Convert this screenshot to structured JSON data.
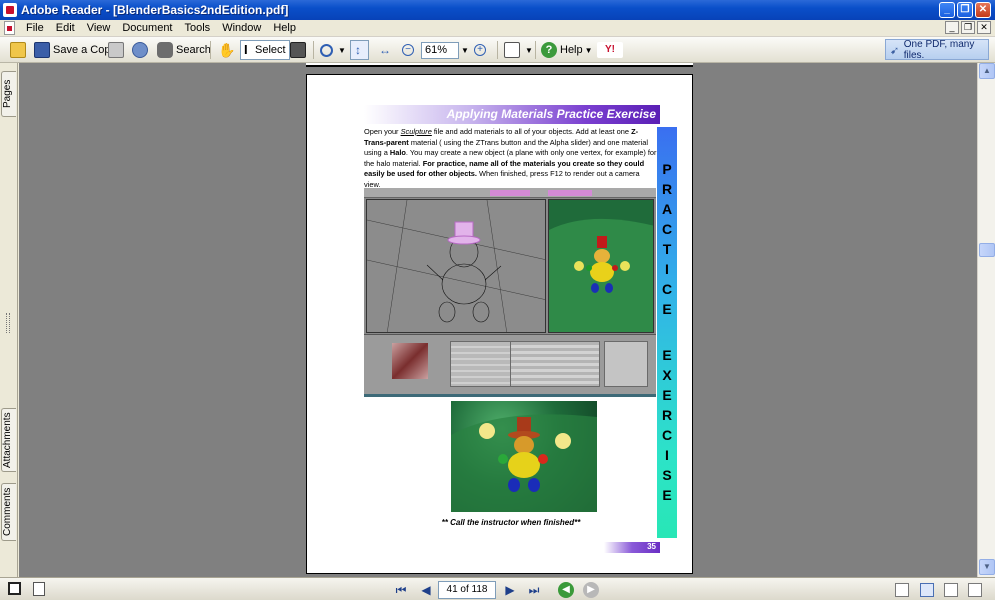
{
  "window": {
    "title": "Adobe Reader - [BlenderBasics2ndEdition.pdf]"
  },
  "menu": [
    "File",
    "Edit",
    "View",
    "Document",
    "Tools",
    "Window",
    "Help"
  ],
  "toolbar": {
    "save_copy_label": "Save a Copy",
    "search_label": "Search",
    "select_label": "Select",
    "zoom_value": "61%",
    "help_label": "Help",
    "promo_text": "One PDF, many files."
  },
  "side_tabs": {
    "pages": "Pages",
    "attachments": "Attachments",
    "comments": "Comments"
  },
  "page": {
    "heading": "Applying Materials Practice Exercise",
    "body_part1": "Open your ",
    "body_sculpture": "Sculpture",
    "body_part2": " file and add materials to all of your objects. Add at least one ",
    "body_bold1": "Z-Trans-parent",
    "body_part3": " material ( using the ZTrans button and the Alpha slider) and one material using a ",
    "body_bold2": "Halo",
    "body_part4": ". You may create a new object (a plane with only one vertex, for example) for the halo material. ",
    "body_bold3": "For practice, name all of the materials you create so they could easily be used for other objects.",
    "body_part5": " When finished, press F12 to render out a camera view.",
    "side_letters_top": [
      "P",
      "R",
      "A",
      "C",
      "T",
      "I",
      "C",
      "E"
    ],
    "side_letters_bottom": [
      "E",
      "X",
      "E",
      "R",
      "C",
      "I",
      "S",
      "E"
    ],
    "caption": "** Call the instructor when finished**",
    "page_number": "35"
  },
  "navigation": {
    "page_indicator": "41 of 118"
  },
  "colors": {
    "titlebar": "#0a4fc9",
    "heading_purple": "#5a1fb5",
    "practice_bar_top": "#3a6ff0",
    "practice_bar_bottom": "#28e6b6"
  }
}
